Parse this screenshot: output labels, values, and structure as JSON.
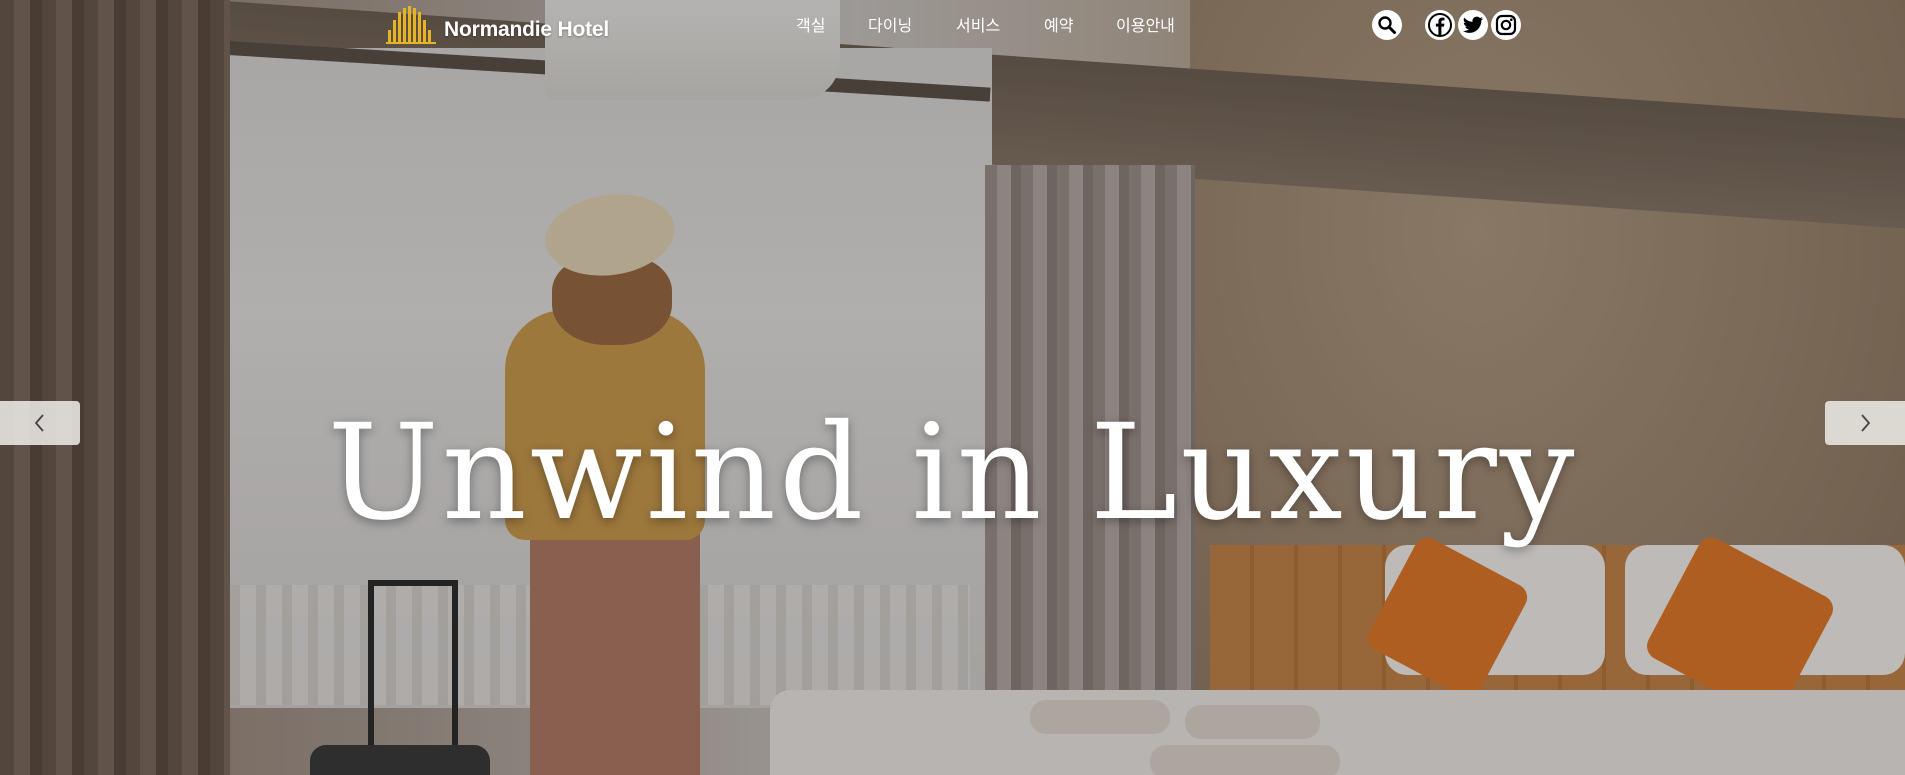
{
  "brand": {
    "name": "Normandie Hotel",
    "logo_icon": "hotel-building-logo",
    "logo_color": "#E6B325"
  },
  "nav": {
    "items": [
      {
        "label": "객실"
      },
      {
        "label": "다이닝"
      },
      {
        "label": "서비스"
      },
      {
        "label": "예약"
      },
      {
        "label": "이용안내"
      }
    ]
  },
  "header_icons": {
    "search": "search-icon",
    "social": [
      "facebook-icon",
      "twitter-icon",
      "instagram-icon"
    ]
  },
  "hero": {
    "title": "Unwind in Luxury",
    "prev_icon": "chevron-left-icon",
    "next_icon": "chevron-right-icon"
  },
  "colors": {
    "text": "#FFFFFF",
    "accent": "#E6B325",
    "arrow_bg": "#EBE8E4"
  }
}
